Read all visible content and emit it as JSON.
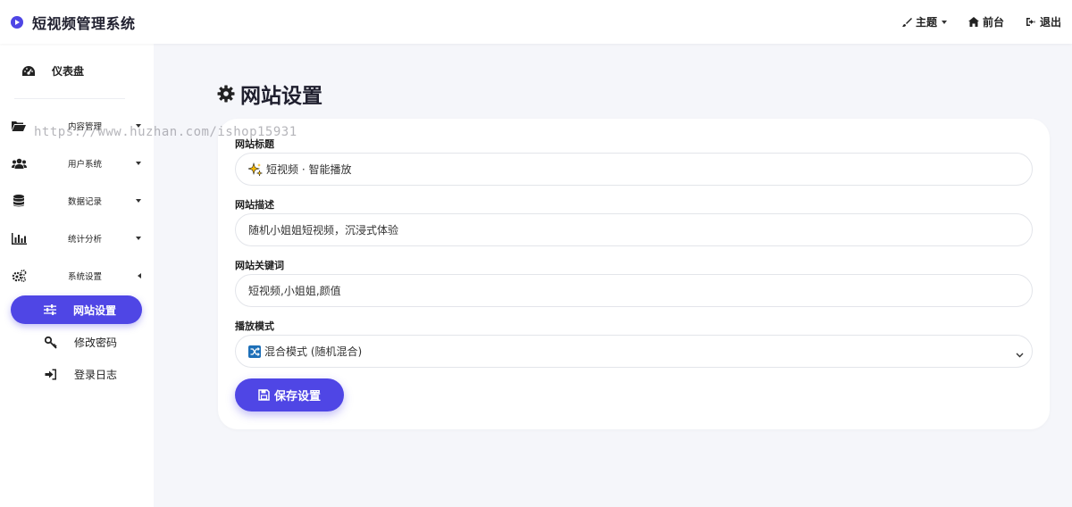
{
  "header": {
    "app_title": "短视频管理系统",
    "theme_label": "主题",
    "frontend_label": "前台",
    "logout_label": "退出"
  },
  "sidebar": {
    "dashboard_label": "仪表盘",
    "items": [
      {
        "label": "内容管理"
      },
      {
        "label": "用户系统"
      },
      {
        "label": "数据记录"
      },
      {
        "label": "统计分析"
      },
      {
        "label": "系统设置"
      }
    ],
    "sub_items": [
      {
        "label": "网站设置",
        "active": true
      },
      {
        "label": "修改密码"
      },
      {
        "label": "登录日志"
      }
    ]
  },
  "watermark": "https://www.huzhan.com/ishop15931",
  "main": {
    "page_title": "网站设置",
    "fields": {
      "site_title": {
        "label": "网站标题",
        "value": "短视频 · 智能播放"
      },
      "site_desc": {
        "label": "网站描述",
        "value": "随机小姐姐短视频，沉浸式体验"
      },
      "site_keywords": {
        "label": "网站关键词",
        "value": "短视频,小姐姐,颜值"
      },
      "play_mode": {
        "label": "播放模式",
        "value": "混合模式 (随机混合)"
      }
    },
    "save_label": "保存设置"
  },
  "colors": {
    "accent": "#4f46e5",
    "background": "#f5f6fa"
  }
}
